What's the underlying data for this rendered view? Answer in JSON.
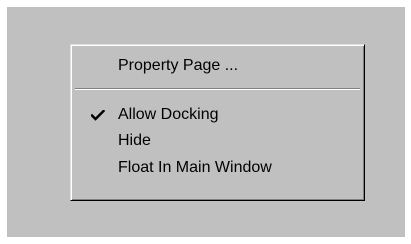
{
  "menu": {
    "items": [
      {
        "label": "Property Page ...",
        "checked": false
      },
      {
        "label": "Allow Docking",
        "checked": true,
        "icon": "checkmark-icon"
      },
      {
        "label": "Hide",
        "checked": false
      },
      {
        "label": "Float In Main Window",
        "checked": false
      }
    ]
  },
  "colors": {
    "background": "#c0c0c0",
    "text": "#000000",
    "separator_dark": "#808080",
    "separator_light": "#ffffff"
  }
}
